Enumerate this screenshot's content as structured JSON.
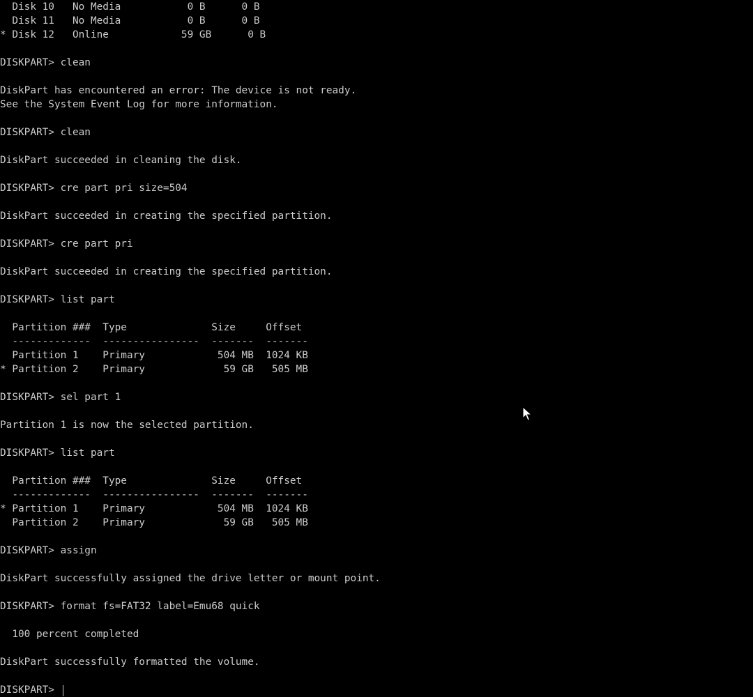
{
  "console": {
    "lines": [
      "  Disk 10   No Media           0 B      0 B",
      "  Disk 11   No Media           0 B      0 B",
      "* Disk 12   Online            59 GB      0 B",
      "",
      "DISKPART> clean",
      "",
      "DiskPart has encountered an error: The device is not ready.",
      "See the System Event Log for more information.",
      "",
      "DISKPART> clean",
      "",
      "DiskPart succeeded in cleaning the disk.",
      "",
      "DISKPART> cre part pri size=504",
      "",
      "DiskPart succeeded in creating the specified partition.",
      "",
      "DISKPART> cre part pri",
      "",
      "DiskPart succeeded in creating the specified partition.",
      "",
      "DISKPART> list part",
      "",
      "  Partition ###  Type              Size     Offset",
      "  -------------  ----------------  -------  -------",
      "  Partition 1    Primary            504 MB  1024 KB",
      "* Partition 2    Primary             59 GB   505 MB",
      "",
      "DISKPART> sel part 1",
      "",
      "Partition 1 is now the selected partition.",
      "",
      "DISKPART> list part",
      "",
      "  Partition ###  Type              Size     Offset",
      "  -------------  ----------------  -------  -------",
      "* Partition 1    Primary            504 MB  1024 KB",
      "  Partition 2    Primary             59 GB   505 MB",
      "",
      "DISKPART> assign",
      "",
      "DiskPart successfully assigned the drive letter or mount point.",
      "",
      "DISKPART> format fs=FAT32 label=Emu68 quick",
      "",
      "  100 percent completed",
      "",
      "DiskPart successfully formatted the volume.",
      "",
      "DISKPART> "
    ]
  },
  "colors": {
    "background": "#000000",
    "text": "#cccccc"
  },
  "icons": {
    "pointer": "mouse-pointer-icon"
  }
}
